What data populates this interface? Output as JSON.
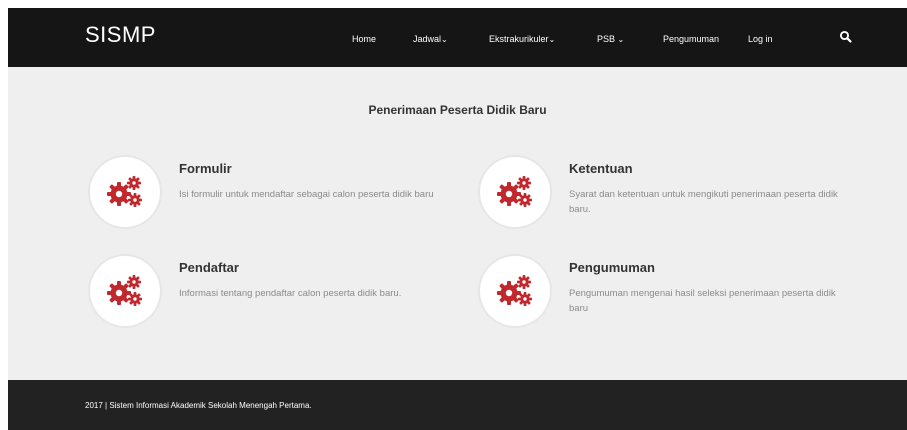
{
  "brand": "SISMP",
  "nav": {
    "home": "Home",
    "jadwal": "Jadwal",
    "ekstra": "Ekstrakurikuler",
    "psb": "PSB",
    "pengumuman": "Pengumuman",
    "login": "Log in",
    "caret": "⌄"
  },
  "section": {
    "title": "Penerimaan Peserta Didik Baru"
  },
  "features": [
    {
      "title": "Formulir",
      "desc": "Isi formulir untuk mendaftar sebagai calon peserta didik baru"
    },
    {
      "title": "Ketentuan",
      "desc": "Syarat dan ketentuan untuk mengikuti penerimaan peserta didik baru."
    },
    {
      "title": "Pendaftar",
      "desc": "Informasi tentang pendaftar calon peserta didik baru."
    },
    {
      "title": "Pengumuman",
      "desc": "Pengumuman mengenai hasil seleksi penerimaan peserta didik baru"
    }
  ],
  "footer": {
    "text": "2017 | Sistem Informasi Akademik Sekolah Menengah Pertama."
  },
  "colors": {
    "navbar": "#151515",
    "icon_red": "#c0282d",
    "footer": "#222222",
    "background": "#efefef"
  },
  "icons": {
    "search": "search-icon",
    "feature": "gears-icon"
  }
}
